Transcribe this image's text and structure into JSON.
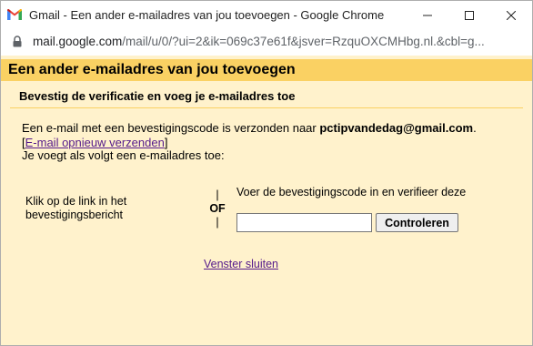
{
  "window": {
    "title": "Gmail - Een ander e-mailadres van jou toevoegen - Google Chrome",
    "url_host": "mail.google.com",
    "url_path": "/mail/u/0/?ui=2&ik=069c37e61f&jsver=RzquOXCMHbg.nl.&cbl=g..."
  },
  "dialog": {
    "header": "Een ander e-mailadres van jou toevoegen",
    "subheader": "Bevestig de verificatie en voeg je e-mailadres toe",
    "message_prefix": "Een e-mail met een bevestigingscode is verzonden naar ",
    "email": "pctipvandedag@gmail.com",
    "message_suffix": ".",
    "resend_open": "[",
    "resend_link": "E-mail opnieuw verzenden",
    "resend_close": "]",
    "adding_text": "Je voegt als volgt een e-mailadres toe:",
    "option_left": "Klik op de link in het bevestigingsbericht",
    "or_label": "OF",
    "or_bar": "|",
    "option_right": "Voer de bevestigingscode in en verifieer deze",
    "code_value": "",
    "verify_button": "Controleren",
    "close_link": "Venster sluiten"
  },
  "colors": {
    "header_bg": "#fad163",
    "content_bg": "#fff2cc",
    "link": "#551a8b"
  }
}
